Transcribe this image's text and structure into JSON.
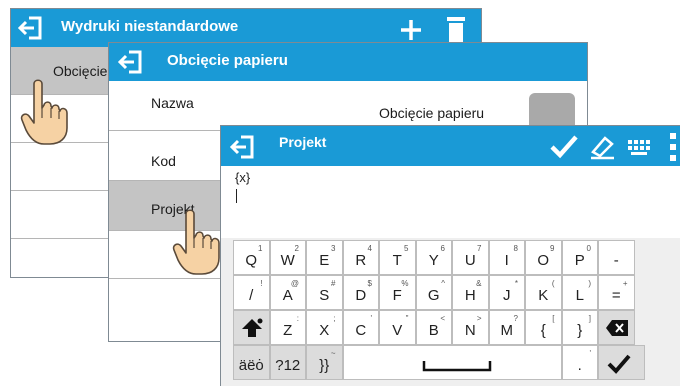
{
  "window1": {
    "title": "Wydruki niestandardowe",
    "first_item": "Obcięcie",
    "icons": [
      "back-icon",
      "plus-icon",
      "trash-icon"
    ]
  },
  "window2": {
    "title": "Obcięcie papieru",
    "rows": [
      {
        "label": "Nazwa",
        "value": "Obcięcie papieru"
      },
      {
        "label": "Kod",
        "value": ""
      },
      {
        "label": "Projekt",
        "value": ""
      }
    ]
  },
  "window3": {
    "title": "Projekt",
    "text_line1": "{x}",
    "icons": [
      "back-icon",
      "check-icon",
      "eraser-icon",
      "keyboard-icon",
      "more-vertical-icon"
    ]
  },
  "keyboard": {
    "row1": [
      {
        "main": "Q",
        "sup": "1"
      },
      {
        "main": "W",
        "sup": "2"
      },
      {
        "main": "E",
        "sup": "3"
      },
      {
        "main": "R",
        "sup": "4"
      },
      {
        "main": "T",
        "sup": "5"
      },
      {
        "main": "Y",
        "sup": "6"
      },
      {
        "main": "U",
        "sup": "7"
      },
      {
        "main": "I",
        "sup": "8"
      },
      {
        "main": "O",
        "sup": "9"
      },
      {
        "main": "P",
        "sup": "0"
      },
      {
        "main": "-",
        "sup": ""
      }
    ],
    "row2": [
      {
        "main": "/",
        "sup": "!"
      },
      {
        "main": "A",
        "sup": "@"
      },
      {
        "main": "S",
        "sup": "#"
      },
      {
        "main": "D",
        "sup": "$"
      },
      {
        "main": "F",
        "sup": "%"
      },
      {
        "main": "G",
        "sup": "^"
      },
      {
        "main": "H",
        "sup": "&"
      },
      {
        "main": "J",
        "sup": "*"
      },
      {
        "main": "K",
        "sup": "("
      },
      {
        "main": "L",
        "sup": ")"
      },
      {
        "main": "=",
        "sup": "+"
      }
    ],
    "row3": [
      {
        "main": "Z",
        "sup": ":"
      },
      {
        "main": "X",
        "sup": ";"
      },
      {
        "main": "C",
        "sup": "'"
      },
      {
        "main": "V",
        "sup": "\""
      },
      {
        "main": "B",
        "sup": "<"
      },
      {
        "main": "N",
        "sup": ">"
      },
      {
        "main": "M",
        "sup": "?"
      },
      {
        "main": "{",
        "sup": "["
      },
      {
        "main": "}",
        "sup": "]"
      }
    ],
    "row4": {
      "accents": "äëȯ",
      "numbers": "?12",
      "brackets": "}}",
      "brackets_sup": "~",
      "dot_sup": "'"
    }
  }
}
